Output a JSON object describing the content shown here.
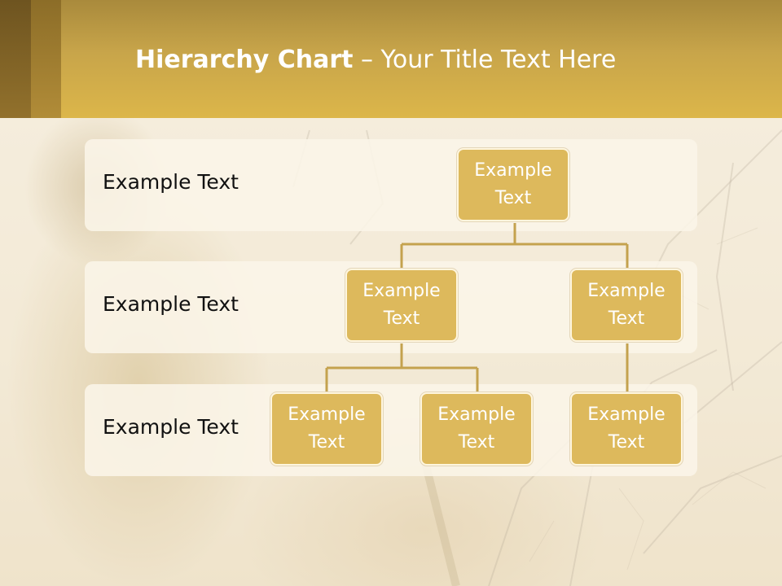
{
  "slide": {
    "title_bold": "Hierarchy Chart",
    "title_rest": " – Your Title Text Here"
  },
  "levels": [
    {
      "label": "Example Text"
    },
    {
      "label": "Example Text"
    },
    {
      "label": "Example Text"
    }
  ],
  "nodes": [
    {
      "line1": "Example",
      "line2": "Text"
    },
    {
      "line1": "Example",
      "line2": "Text"
    },
    {
      "line1": "Example",
      "line2": "Text"
    },
    {
      "line1": "Example",
      "line2": "Text"
    },
    {
      "line1": "Example",
      "line2": "Text"
    },
    {
      "line1": "Example",
      "line2": "Text"
    }
  ],
  "colors": {
    "header": "#d4b04a",
    "node_fill": "#ddb95c",
    "connector": "#c4a24e"
  }
}
